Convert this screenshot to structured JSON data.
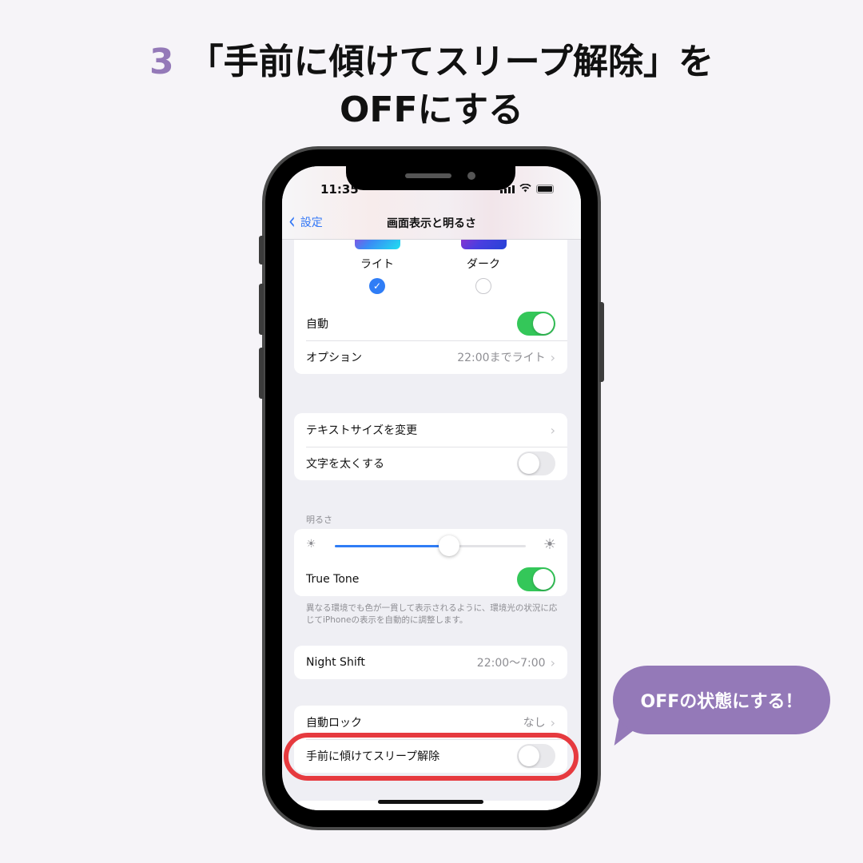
{
  "headline": {
    "step_number": "3",
    "line1": "「手前に傾けてスリープ解除」を",
    "line2": "OFFにする"
  },
  "callout": {
    "text": "OFFの状態にする！"
  },
  "accent_colors": {
    "purple": "#9479b8",
    "highlight_red": "#e63a3f",
    "ios_blue": "#2f7df6",
    "ios_green": "#34c759"
  },
  "phone": {
    "status_bar": {
      "time": "11:35",
      "icons": [
        "signal-icon",
        "wifi-icon",
        "battery-icon"
      ]
    },
    "nav": {
      "back_label": "設定",
      "title": "画面表示と明るさ"
    },
    "appearance": {
      "options": [
        {
          "label": "ライト",
          "selected": true
        },
        {
          "label": "ダーク",
          "selected": false
        }
      ],
      "rows": [
        {
          "label": "自動",
          "toggle": true
        },
        {
          "label": "オプション",
          "value": "22:00までライト"
        }
      ]
    },
    "text_group": [
      {
        "label": "テキストサイズを変更"
      },
      {
        "label": "文字を太くする",
        "toggle": false
      }
    ],
    "brightness": {
      "header": "明るさ",
      "level_percent": 60,
      "true_tone_label": "True Tone",
      "true_tone_on": true,
      "footnote": "異なる環境でも色が一貫して表示されるように、環境光の状況に応じてiPhoneの表示を自動的に調整します。"
    },
    "night_shift": {
      "label": "Night Shift",
      "value": "22:00〜7:00"
    },
    "lock_group": [
      {
        "label": "自動ロック",
        "value": "なし"
      },
      {
        "label": "手前に傾けてスリープ解除",
        "toggle": false
      }
    ]
  }
}
